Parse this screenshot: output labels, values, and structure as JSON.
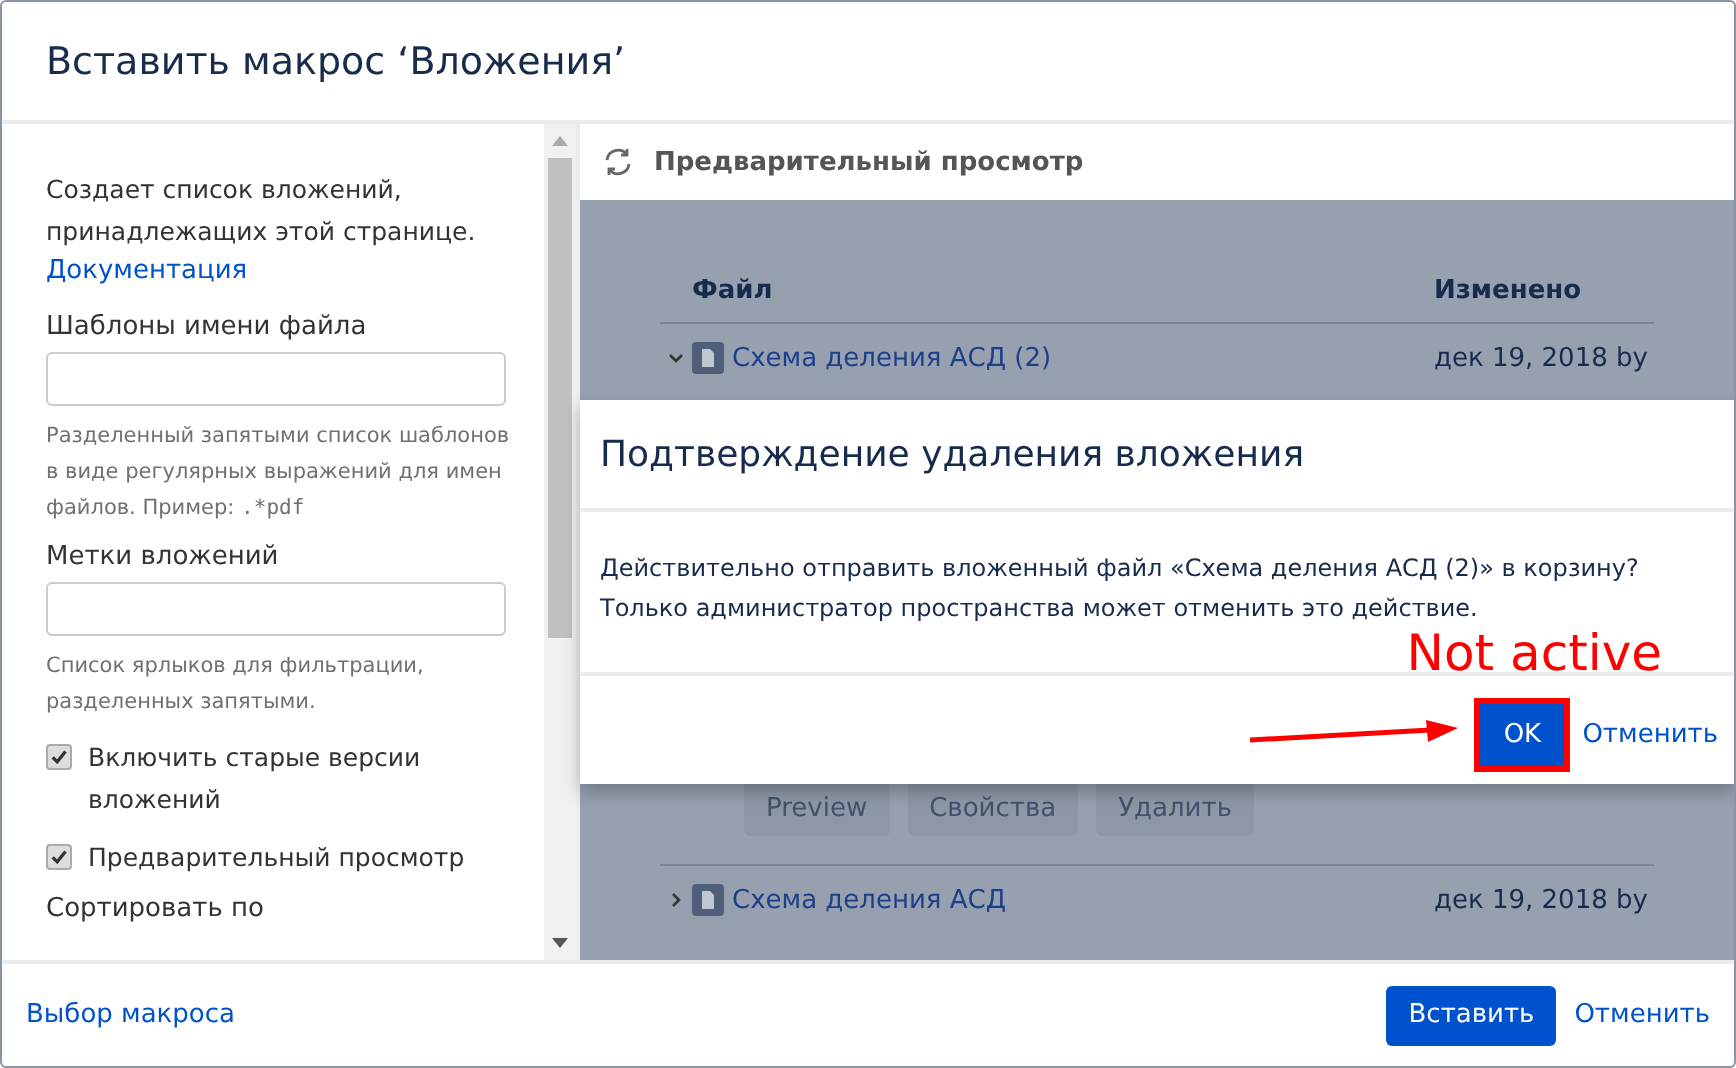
{
  "window": {
    "title": "Вставить макрос ‘Вложения’"
  },
  "sidebar": {
    "description": "Создает список вложений, принадлежащих этой странице.",
    "doc_link": "Документация",
    "fields": [
      {
        "label": "Шаблоны имени файла",
        "hint": "Разделенный запятыми список шаблонов в виде регулярных выражений для имен файлов. Пример: ",
        "hint_code": ".*pdf"
      },
      {
        "label": "Метки вложений",
        "hint": "Список ярлыков для фильтрации, разделенных запятыми."
      }
    ],
    "checkboxes": [
      {
        "label": "Включить старые версии вложений",
        "checked": true
      },
      {
        "label": "Предварительный просмотр",
        "checked": true
      }
    ],
    "sort_label": "Сортировать по"
  },
  "preview": {
    "title": "Предварительный просмотр",
    "columns": [
      "Файл",
      "Изменено"
    ],
    "rows": [
      {
        "name": "Схема деления АСД (2)",
        "expanded": true,
        "modified": "дек 19, 2018 by"
      },
      {
        "name": "Схема деления АСД",
        "expanded": false,
        "modified": "дек 19, 2018 by"
      }
    ],
    "actions": [
      "Preview",
      "Свойства",
      "Удалить"
    ]
  },
  "confirm": {
    "title": "Подтверждение удаления вложения",
    "message_lines": [
      "Действительно отправить вложенный файл «Схема деления АСД (2)» в корзину?",
      "Только администратор пространства может отменить это действие."
    ],
    "ok": "OK",
    "cancel": "Отменить"
  },
  "annotation": {
    "text": "Not active"
  },
  "footer": {
    "link": "Выбор макроса",
    "primary": "Вставить",
    "cancel": "Отменить"
  }
}
